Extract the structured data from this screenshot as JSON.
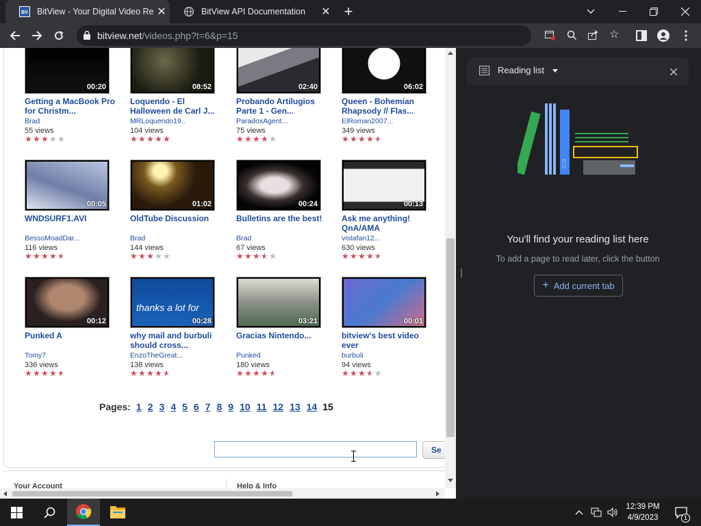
{
  "browser": {
    "tabs": [
      {
        "title": "BitView - Your Digital Video Repo",
        "favicon": "bitview-favicon-icon",
        "active": true
      },
      {
        "title": "BitView API Documentation",
        "favicon": "globe-icon",
        "active": false
      }
    ],
    "url_host": "bitview.net",
    "url_path": "/videos.php?t=6&p=15"
  },
  "videos": [
    {
      "title": "Getting a MacBook Pro for Christm...",
      "user": "Brad",
      "views": "55 views",
      "duration": "00:20",
      "rating": 3
    },
    {
      "title": "Loquendo - El Halloween de Carl J...",
      "user": "MRLoquendo19..",
      "views": "104 views",
      "duration": "08:52",
      "rating": 5
    },
    {
      "title": "Probando Artilugios Parte 1 - Gen...",
      "user": "ParadoxAgent...",
      "views": "75 views",
      "duration": "02:40",
      "rating": 4
    },
    {
      "title": "Queen - Bohemian Rhapsody // Flas...",
      "user": "ElRoman2007...",
      "views": "349 views",
      "duration": "06:02",
      "rating": 4.5
    },
    {
      "title": "WNDSURF1.AVI",
      "user": "BessoMoadDar...",
      "views": "116 views",
      "duration": "00:05",
      "rating": 4.5
    },
    {
      "title": "OldTube Discussion",
      "user": "Brad",
      "views": "144 views",
      "duration": "01:02",
      "rating": 3
    },
    {
      "title": "Bulletins are the best!",
      "user": "Brad",
      "views": "67 views",
      "duration": "00:24",
      "rating": 3.5
    },
    {
      "title": "Ask me anything! QnA/AMA",
      "user": "vistafan12...",
      "views": "630 views",
      "duration": "00:13",
      "rating": 4.5
    },
    {
      "title": "Punked A",
      "user": "Tomy7",
      "views": "336 views",
      "duration": "00:12",
      "rating": 4.5
    },
    {
      "title": "why mail and burbuli should cross...",
      "user": "EnzoTheGreat...",
      "views": "138 views",
      "duration": "00:28",
      "rating": 4.5
    },
    {
      "title": "Gracias Nintendo...",
      "user": "Punked",
      "views": "180 views",
      "duration": "03:21",
      "rating": 4.5
    },
    {
      "title": "bitview's best video ever",
      "user": "burbuli",
      "views": "94 views",
      "duration": "00:01",
      "rating": 3.5
    }
  ],
  "pager": {
    "label": "Pages:",
    "pages": [
      "1",
      "2",
      "3",
      "4",
      "5",
      "6",
      "7",
      "8",
      "9",
      "10",
      "11",
      "12",
      "13",
      "14"
    ],
    "current": "15"
  },
  "search": {
    "value": "",
    "button": "Se"
  },
  "footer": {
    "left": "Your Account",
    "right": "Help & Info"
  },
  "reading_list": {
    "title": "Reading list",
    "empty_title": "You'll find your reading list here",
    "empty_subtitle": "To add a page to read later, click the button",
    "add_button": "Add current tab"
  },
  "taskbar": {
    "time": "12:39 PM",
    "date": "4/9/2023",
    "notifications": "1"
  },
  "colors": {
    "link": "#1e4b9c",
    "star_on": "#cc4e5c",
    "star_off": "#bbbbbb",
    "accent": "#8ab4f8"
  }
}
